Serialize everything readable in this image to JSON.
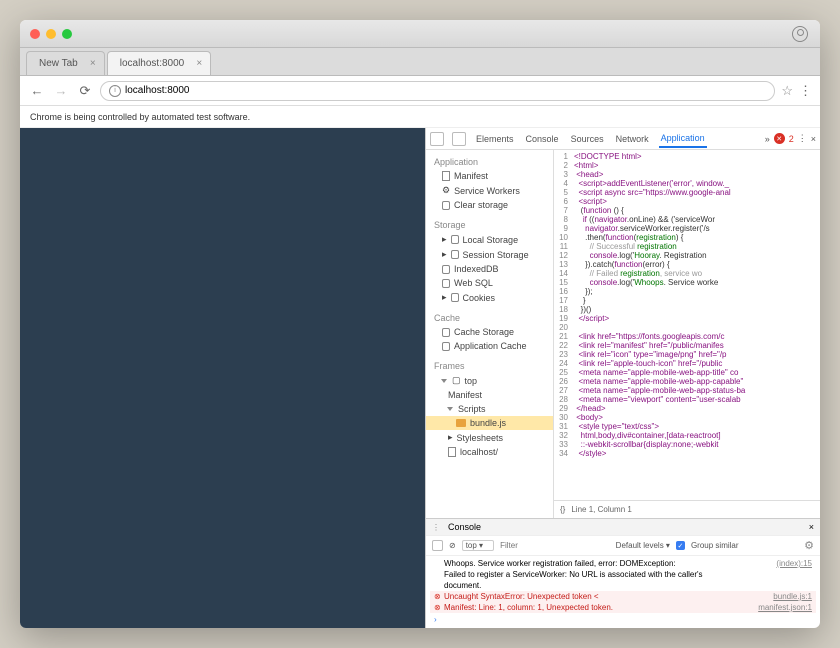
{
  "tabs": [
    {
      "label": "New Tab"
    },
    {
      "label": "localhost:8000"
    }
  ],
  "address": "localhost:8000",
  "infobar": "Chrome is being controlled by automated test software.",
  "devtools": {
    "tabs": [
      "Elements",
      "Console",
      "Sources",
      "Network",
      "Application"
    ],
    "active_tab": "Application",
    "error_count": "2",
    "more": "»",
    "sidebar": {
      "app_title": "Application",
      "app_items": [
        "Manifest",
        "Service Workers",
        "Clear storage"
      ],
      "storage_title": "Storage",
      "storage_items": [
        "Local Storage",
        "Session Storage",
        "IndexedDB",
        "Web SQL",
        "Cookies"
      ],
      "cache_title": "Cache",
      "cache_items": [
        "Cache Storage",
        "Application Cache"
      ],
      "frames_title": "Frames",
      "top": "top",
      "frames_children": [
        "Manifest",
        "Scripts"
      ],
      "bundle": "bundle.js",
      "stylesheets": "Stylesheets",
      "localhost": "localhost/"
    },
    "status": "Line 1, Column 1",
    "source": [
      {
        "n": "1",
        "c": "<!DOCTYPE html>"
      },
      {
        "n": "2",
        "c": "<html>"
      },
      {
        "n": "3",
        "c": " <head>"
      },
      {
        "n": "4",
        "c": "  <script>addEventListener('error', window._"
      },
      {
        "n": "5",
        "c": "  <script async src=\"https://www.google-anal"
      },
      {
        "n": "6",
        "c": "  <script>"
      },
      {
        "n": "7",
        "c": "   (function () {"
      },
      {
        "n": "8",
        "c": "    if ((navigator.onLine) && ('serviceWor"
      },
      {
        "n": "9",
        "c": "     navigator.serviceWorker.register('/s"
      },
      {
        "n": "10",
        "c": "     .then(function(registration) {"
      },
      {
        "n": "11",
        "c": "       // Successful registration"
      },
      {
        "n": "12",
        "c": "       console.log('Hooray. Registration"
      },
      {
        "n": "13",
        "c": "     }).catch(function(error) {"
      },
      {
        "n": "14",
        "c": "       // Failed registration, service wo"
      },
      {
        "n": "15",
        "c": "       console.log('Whoops. Service worke"
      },
      {
        "n": "16",
        "c": "     });"
      },
      {
        "n": "17",
        "c": "    }"
      },
      {
        "n": "18",
        "c": "   })()"
      },
      {
        "n": "19",
        "c": "  </script>"
      },
      {
        "n": "20",
        "c": ""
      },
      {
        "n": "21",
        "c": "  <link href=\"https://fonts.googleapis.com/c"
      },
      {
        "n": "22",
        "c": "  <link rel=\"manifest\" href=\"/public/manifes"
      },
      {
        "n": "23",
        "c": "  <link rel=\"icon\" type=\"image/png\" href=\"/p"
      },
      {
        "n": "24",
        "c": "  <link rel=\"apple-touch-icon\" href=\"/public"
      },
      {
        "n": "25",
        "c": "  <meta name=\"apple-mobile-web-app-title\" co"
      },
      {
        "n": "26",
        "c": "  <meta name=\"apple-mobile-web-app-capable\" "
      },
      {
        "n": "27",
        "c": "  <meta name=\"apple-mobile-web-app-status-ba"
      },
      {
        "n": "28",
        "c": "  <meta name=\"viewport\" content=\"user-scalab"
      },
      {
        "n": "29",
        "c": " </head>"
      },
      {
        "n": "30",
        "c": " <body>"
      },
      {
        "n": "31",
        "c": "  <style type=\"text/css\">"
      },
      {
        "n": "32",
        "c": "   html,body,div#container,[data-reactroot]"
      },
      {
        "n": "33",
        "c": "   ::-webkit-scrollbar{display:none;-webkit"
      },
      {
        "n": "34",
        "c": "  </style>"
      }
    ]
  },
  "console": {
    "title": "Console",
    "context": "top",
    "filter_placeholder": "Filter",
    "levels": "Default levels",
    "group_similar": "Group similar",
    "messages": [
      {
        "type": "plain",
        "text": "Whoops. Service worker registration failed, error: DOMException:",
        "link": "(index):15"
      },
      {
        "type": "plain",
        "text": "Failed to register a ServiceWorker: No URL is associated with the caller's",
        "link": ""
      },
      {
        "type": "plain",
        "text": "document.",
        "link": ""
      },
      {
        "type": "err",
        "text": "Uncaught SyntaxError: Unexpected token <",
        "link": "bundle.js:1"
      },
      {
        "type": "err",
        "text": "Manifest: Line: 1, column: 1, Unexpected token.",
        "link": "manifest.json:1"
      }
    ]
  }
}
